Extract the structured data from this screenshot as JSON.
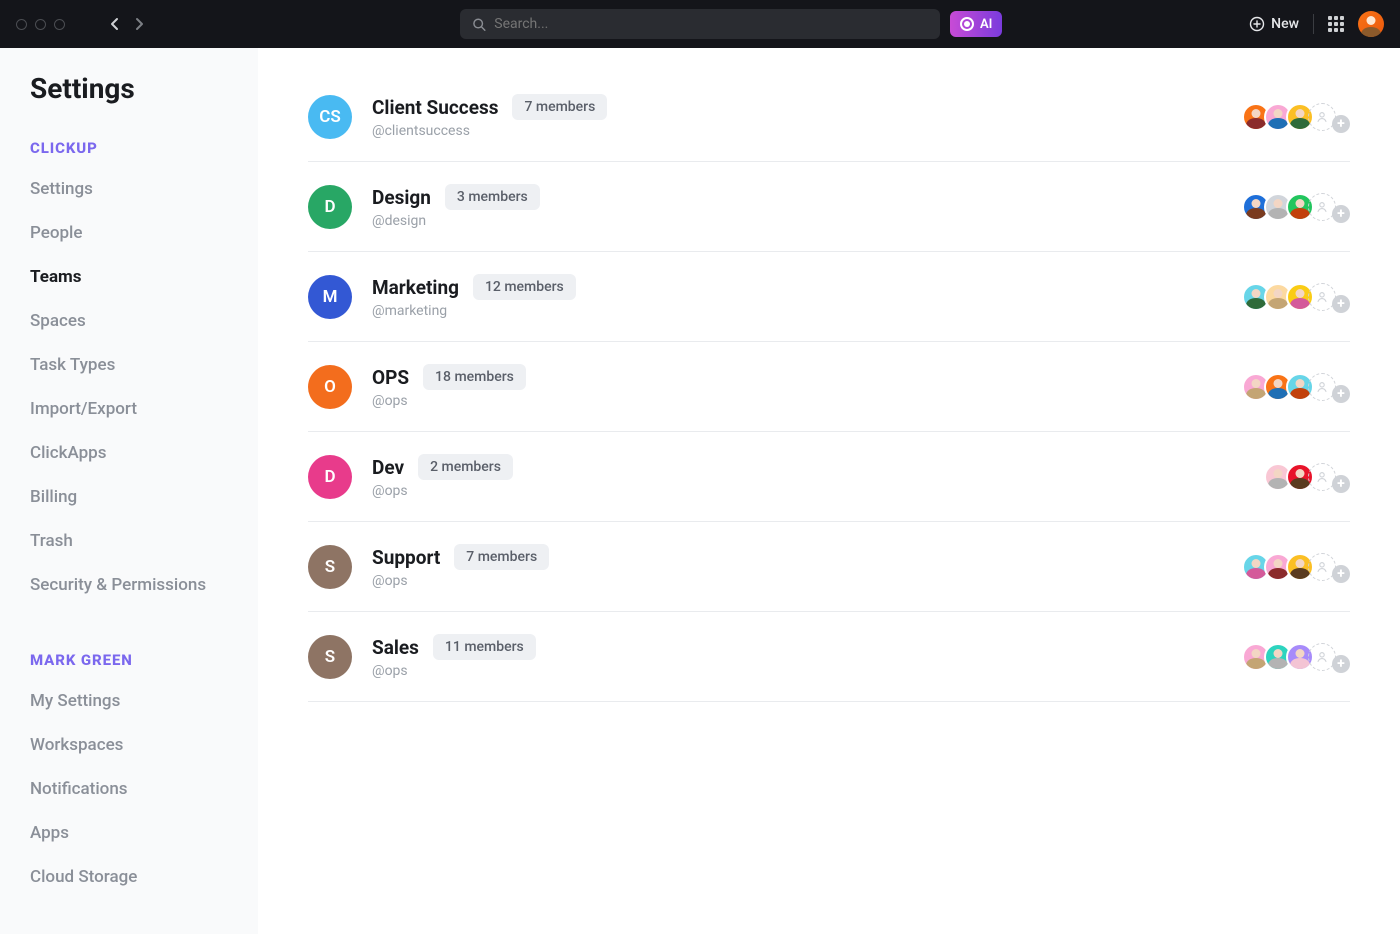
{
  "topbar": {
    "search_placeholder": "Search...",
    "ai_label": "AI",
    "new_label": "New"
  },
  "sidebar": {
    "title": "Settings",
    "sections": [
      {
        "header": "CLICKUP",
        "items": [
          {
            "label": "Settings",
            "active": false
          },
          {
            "label": "People",
            "active": false
          },
          {
            "label": "Teams",
            "active": true
          },
          {
            "label": "Spaces",
            "active": false
          },
          {
            "label": "Task Types",
            "active": false
          },
          {
            "label": "Import/Export",
            "active": false
          },
          {
            "label": "ClickApps",
            "active": false
          },
          {
            "label": "Billing",
            "active": false
          },
          {
            "label": "Trash",
            "active": false
          },
          {
            "label": "Security & Permissions",
            "active": false
          }
        ]
      },
      {
        "header": "MARK GREEN",
        "items": [
          {
            "label": "My Settings",
            "active": false
          },
          {
            "label": "Workspaces",
            "active": false
          },
          {
            "label": "Notifications",
            "active": false
          },
          {
            "label": "Apps",
            "active": false
          },
          {
            "label": "Cloud Storage",
            "active": false
          }
        ]
      }
    ]
  },
  "teams": [
    {
      "initials": "CS",
      "color": "#49baf2",
      "name": "Client Success",
      "handle": "@clientsuccess",
      "members_label": "7 members",
      "avatars": [
        {
          "bg": "#f97316",
          "shirt": "#8b2b2b"
        },
        {
          "bg": "#f9a8d4",
          "shirt": "#1f6fb5"
        },
        {
          "bg": "#fbbf24",
          "shirt": "#2f6b3a"
        }
      ]
    },
    {
      "initials": "D",
      "color": "#28a765",
      "name": "Design",
      "handle": "@design",
      "members_label": "3 members",
      "avatars": [
        {
          "bg": "#1e6fd9",
          "shirt": "#7a3b1f"
        },
        {
          "bg": "#d1d5db",
          "shirt": "#b3b3b3"
        },
        {
          "bg": "#22c55e",
          "shirt": "#c2410c"
        }
      ]
    },
    {
      "initials": "M",
      "color": "#3358d4",
      "name": "Marketing",
      "handle": "@marketing",
      "members_label": "12 members",
      "avatars": [
        {
          "bg": "#67d5e8",
          "shirt": "#2f6b3a"
        },
        {
          "bg": "#fcd9a0",
          "shirt": "#c4a574"
        },
        {
          "bg": "#facc15",
          "shirt": "#d45a9a"
        }
      ]
    },
    {
      "initials": "O",
      "color": "#f36d1d",
      "name": "OPS",
      "handle": "@ops",
      "members_label": "18 members",
      "avatars": [
        {
          "bg": "#f9a8d4",
          "shirt": "#c4a574"
        },
        {
          "bg": "#f97316",
          "shirt": "#1f6fb5"
        },
        {
          "bg": "#67d5e8",
          "shirt": "#c2410c"
        }
      ]
    },
    {
      "initials": "D",
      "color": "#e83b8b",
      "name": "Dev",
      "handle": "@ops",
      "members_label": "2 members",
      "avatars": [
        {
          "bg": "#f9c7d4",
          "shirt": "#b3b3b3"
        },
        {
          "bg": "#e8132a",
          "shirt": "#5a3b1f"
        }
      ]
    },
    {
      "initials": "S",
      "color": "#8e7464",
      "name": "Support",
      "handle": "@ops",
      "members_label": "7 members",
      "avatars": [
        {
          "bg": "#67d5e8",
          "shirt": "#d45a9a"
        },
        {
          "bg": "#f9a8d4",
          "shirt": "#8b2b2b"
        },
        {
          "bg": "#fbbf24",
          "shirt": "#5a3b1f"
        }
      ]
    },
    {
      "initials": "S",
      "color": "#8e7464",
      "name": "Sales",
      "handle": "@ops",
      "members_label": "11 members",
      "avatars": [
        {
          "bg": "#f9a8d4",
          "shirt": "#c4a574"
        },
        {
          "bg": "#2dd4bf",
          "shirt": "#b3b3b3"
        },
        {
          "bg": "#a78bfa",
          "shirt": "#f3c4d4"
        }
      ]
    }
  ]
}
